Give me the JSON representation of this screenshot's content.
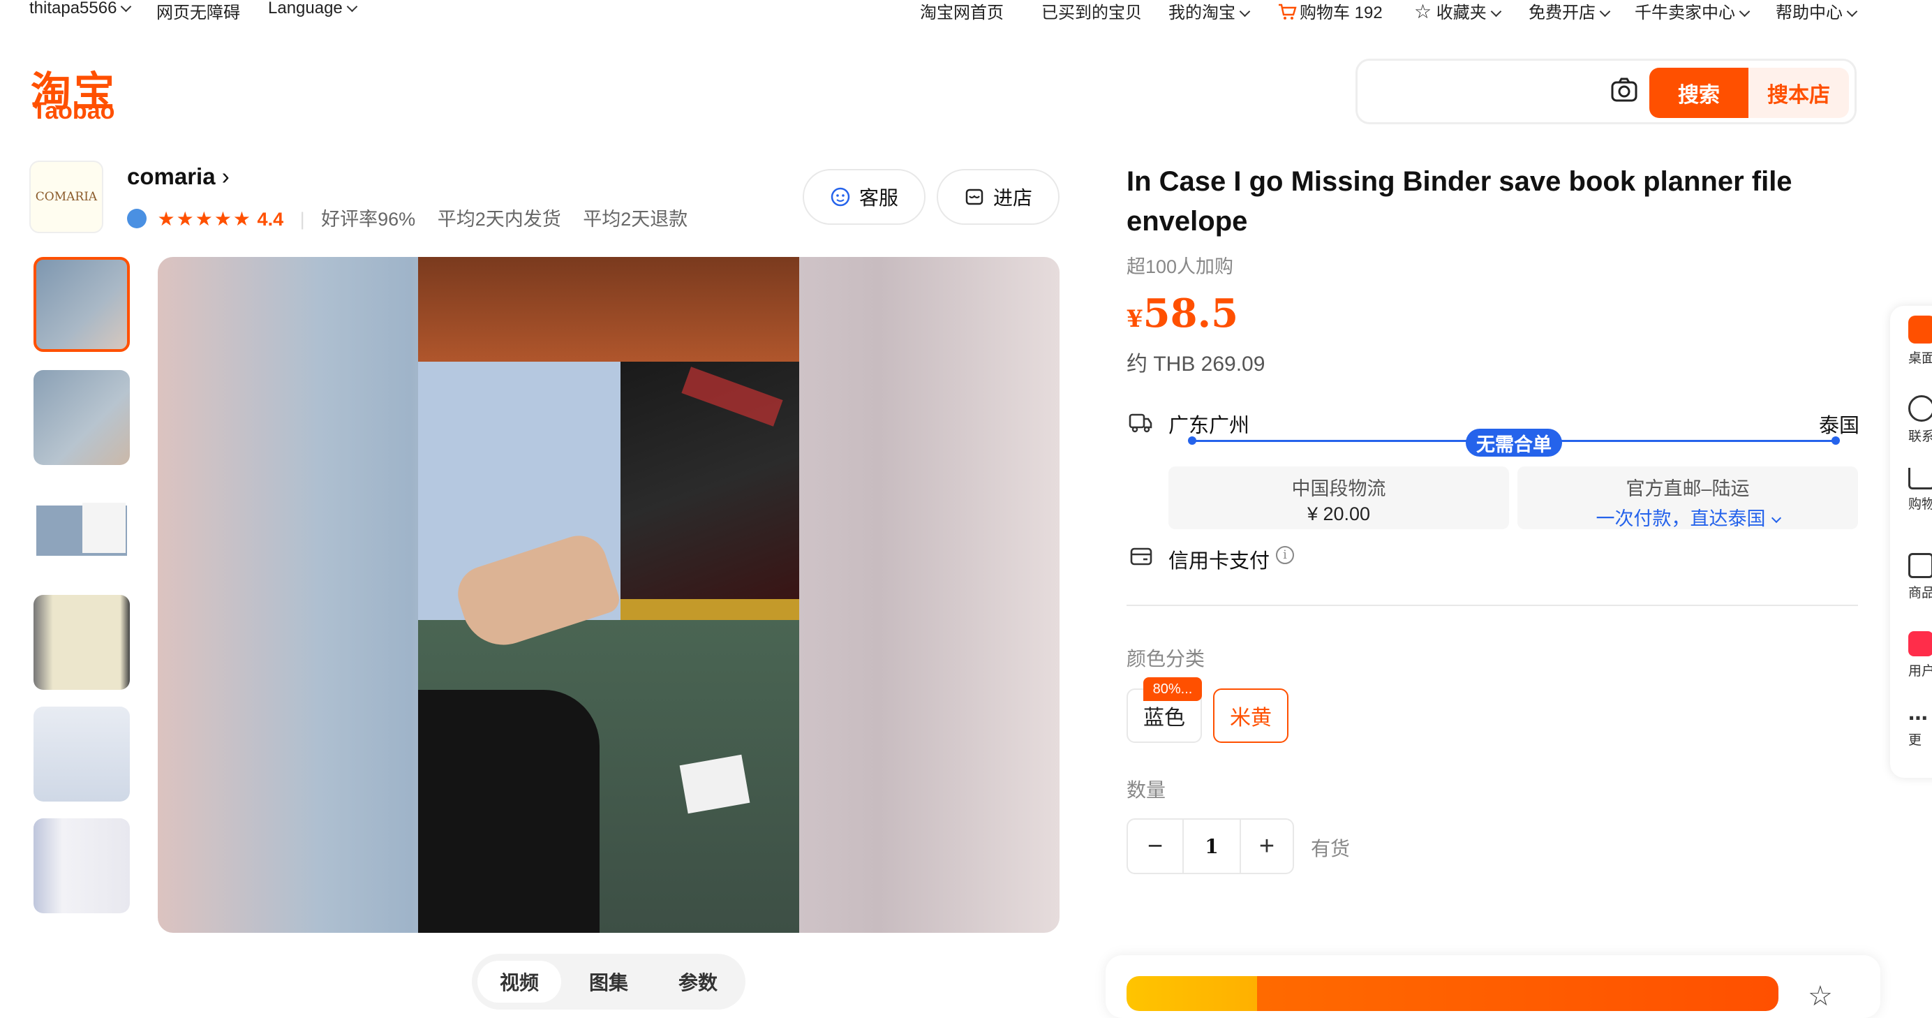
{
  "topbar": {
    "username": "thitapa5566",
    "accessibility": "网页无障碍",
    "language": "Language",
    "home": "淘宝网首页",
    "bought": "已买到的宝贝",
    "my_taobao": "我的淘宝",
    "cart": "购物车 192",
    "favorites": "收藏夹",
    "open_store": "免费开店",
    "seller_center": "千牛卖家中心",
    "help_center": "帮助中心"
  },
  "logo": {
    "cn": "淘宝",
    "en": "Taobao"
  },
  "search": {
    "value": "",
    "placeholder": "",
    "button": "搜索",
    "store_button": "搜本店"
  },
  "shop": {
    "logo_text": "COMARIA",
    "name": "comaria",
    "stars": "★★★★★",
    "rating": "4.4",
    "positive_rate": "好评率96%",
    "avg_ship": "平均2天内发货",
    "avg_refund": "平均2天退款",
    "service_label": "客服",
    "enter_store_label": "进店"
  },
  "gallery": {
    "tabs": [
      "视频",
      "图集",
      "参数"
    ],
    "active_tab": "视频"
  },
  "product": {
    "title": "In Case I go Missing Binder save book planner file envelope",
    "sold": "超100人加购",
    "currency": "¥",
    "price": "58.5",
    "approx": "约 THB 269.09"
  },
  "shipping": {
    "origin": "广东广州",
    "destination": "泰国",
    "badge": "无需合单",
    "china_leg_title": "中国段物流",
    "china_leg_price": "¥ 20.00",
    "intl_title": "官方直邮–陆运",
    "intl_desc": "一次付款，直达泰国",
    "payment": "信用卡支付"
  },
  "options": {
    "color_label": "颜色分类",
    "colors": [
      {
        "name": "蓝色",
        "tag": "80%...",
        "selected": false
      },
      {
        "name": "米黄",
        "tag": "",
        "selected": true
      }
    ],
    "qty_label": "数量",
    "qty": "1",
    "stock": "有货"
  },
  "side": {
    "items": [
      "桌面",
      "联系",
      "购物",
      "商品",
      "用户",
      "更"
    ]
  },
  "colors": {
    "accent": "#ff5000",
    "blue": "#2563eb"
  }
}
